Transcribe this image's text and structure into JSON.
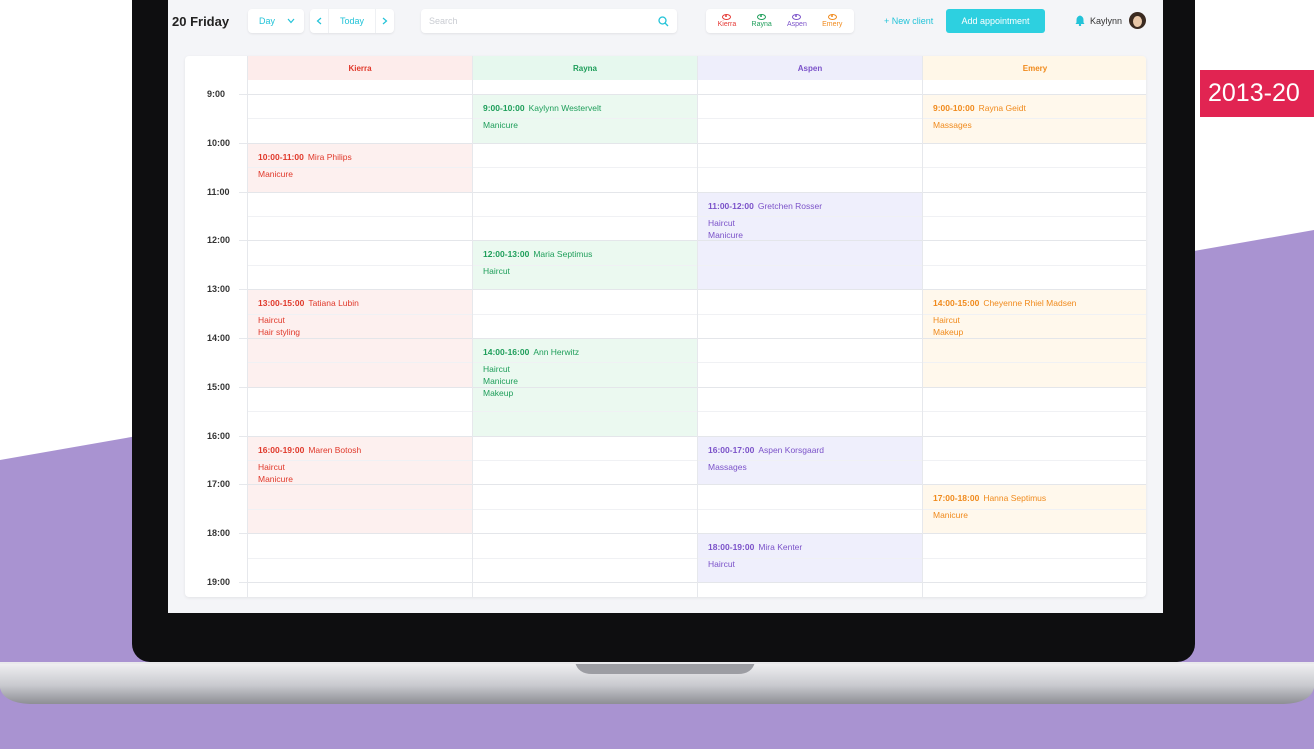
{
  "colors": {
    "background_purple": "#a993d1",
    "accent": "#2dd0e0",
    "tag_red": "#e12452"
  },
  "corner_tag": "2013-20",
  "toolbar": {
    "date": "20 Friday",
    "view_label": "Day",
    "view_chevron_icon": "chevron-down-icon",
    "prev_icon": "chevron-left-icon",
    "today_label": "Today",
    "next_icon": "chevron-right-icon",
    "search_placeholder": "Search",
    "search_icon": "search-icon",
    "staff_filter": [
      {
        "name": "Kierra",
        "color": "#e53935",
        "icon": "eye-icon"
      },
      {
        "name": "Rayna",
        "color": "#1e9e5a",
        "icon": "eye-icon"
      },
      {
        "name": "Aspen",
        "color": "#7b52c9",
        "icon": "eye-icon"
      },
      {
        "name": "Emery",
        "color": "#f08a1c",
        "icon": "eye-icon"
      }
    ],
    "new_client_label": "+ New client",
    "add_appointment_label": "Add appointment",
    "notification_icon": "bell-icon",
    "user_name": "Kaylynn",
    "avatar_icon": "avatar"
  },
  "calendar": {
    "times": [
      "9:00",
      "10:00",
      "11:00",
      "12:00",
      "13:00",
      "14:00",
      "15:00",
      "16:00",
      "17:00",
      "18:00",
      "19:00"
    ],
    "staff": [
      {
        "name": "Kierra",
        "color": "#e0392b",
        "header_bg": "#fdeceb",
        "block_bg": "#fdf0ef",
        "line": "#f6dcda",
        "appointments": [
          {
            "start": 10,
            "end": 11,
            "time": "10:00-11:00",
            "client": "Mira Philips",
            "services": [
              "Manicure"
            ]
          },
          {
            "start": 13,
            "end": 15,
            "time": "13:00-15:00",
            "client": "Tatiana Lubin",
            "services": [
              "Haircut",
              "Hair styling"
            ]
          },
          {
            "start": 16,
            "end": 18,
            "time": "16:00-19:00",
            "client": "Maren Botosh",
            "services": [
              "Haircut",
              "Manicure"
            ]
          }
        ]
      },
      {
        "name": "Rayna",
        "color": "#1e9e5a",
        "header_bg": "#e6f8ee",
        "block_bg": "#ebf9f0",
        "line": "#d4efe0",
        "appointments": [
          {
            "start": 9,
            "end": 10,
            "time": "9:00-10:00",
            "client": "Kaylynn Westervelt",
            "services": [
              "Manicure"
            ]
          },
          {
            "start": 12,
            "end": 13,
            "time": "12:00-13:00",
            "client": "Maria Septimus",
            "services": [
              "Haircut"
            ]
          },
          {
            "start": 14,
            "end": 16,
            "time": "14:00-16:00",
            "client": "Ann Herwitz",
            "services": [
              "Haircut",
              "Manicure",
              "Makeup"
            ]
          }
        ]
      },
      {
        "name": "Aspen",
        "color": "#7b52c9",
        "header_bg": "#eeeefb",
        "block_bg": "#efeffc",
        "line": "#dcdcf2",
        "appointments": [
          {
            "start": 11,
            "end": 13,
            "time": "11:00-12:00",
            "client": "Gretchen Rosser",
            "services": [
              "Haircut",
              "Manicure"
            ]
          },
          {
            "start": 16,
            "end": 17,
            "time": "16:00-17:00",
            "client": "Aspen Korsgaard",
            "services": [
              "Massages"
            ]
          },
          {
            "start": 18,
            "end": 19,
            "time": "18:00-19:00",
            "client": "Mira Kenter",
            "services": [
              "Haircut"
            ]
          }
        ]
      },
      {
        "name": "Emery",
        "color": "#f08a1c",
        "header_bg": "#fff7e8",
        "block_bg": "#fff8ec",
        "line": "#f5ead6",
        "appointments": [
          {
            "start": 9,
            "end": 10,
            "time": "9:00-10:00",
            "client": "Rayna Geidt",
            "services": [
              "Massages"
            ]
          },
          {
            "start": 13,
            "end": 15,
            "time": "14:00-15:00",
            "client": "Cheyenne Rhiel Madsen",
            "services": [
              "Haircut",
              "Makeup"
            ]
          },
          {
            "start": 17,
            "end": 18,
            "time": "17:00-18:00",
            "client": "Hanna Septimus",
            "services": [
              "Manicure"
            ]
          }
        ]
      }
    ]
  }
}
